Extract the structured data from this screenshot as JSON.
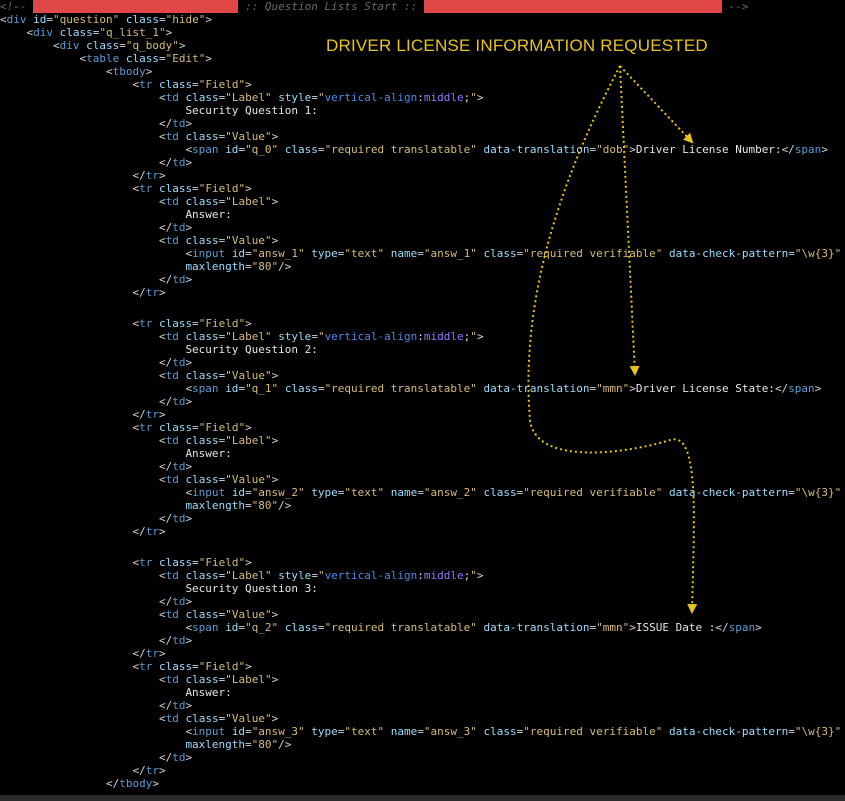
{
  "annotation": {
    "headline": "DRIVER LICENSE INFORMATION REQUESTED",
    "color": "#E8C21E"
  },
  "code": {
    "comment_open": "<!--",
    "comment_bar": "-------------------------------",
    "comment_label": " :: Question Lists Start :: ",
    "comment_bar2": "---------------------------------------------",
    "comment_close": " -->",
    "q1_label": "Security Question 1:",
    "q1_span_id": "\"q_0\"",
    "q1_translation": "\"dob\"",
    "q1_text": "Driver License Number:",
    "q2_label": "Security Question 2:",
    "q2_span_id": "\"q_1\"",
    "q2_translation": "\"mmn\"",
    "q2_text": "Driver License State:",
    "q3_label": "Security Question 3:",
    "q3_span_id": "\"q_2\"",
    "q3_translation": "\"mmn\"",
    "q3_text": "ISSUE Date :",
    "answer_label": "Answer:",
    "input1_id": "\"answ_1\"",
    "input1_name": "\"answ_1\"",
    "input2_id": "\"answ_2\"",
    "input2_name": "\"answ_2\"",
    "input3_id": "\"answ_3\"",
    "input3_name": "\"answ_3\"",
    "pattern": "\"\\w{3}\"",
    "maxlength": "\"80\""
  }
}
